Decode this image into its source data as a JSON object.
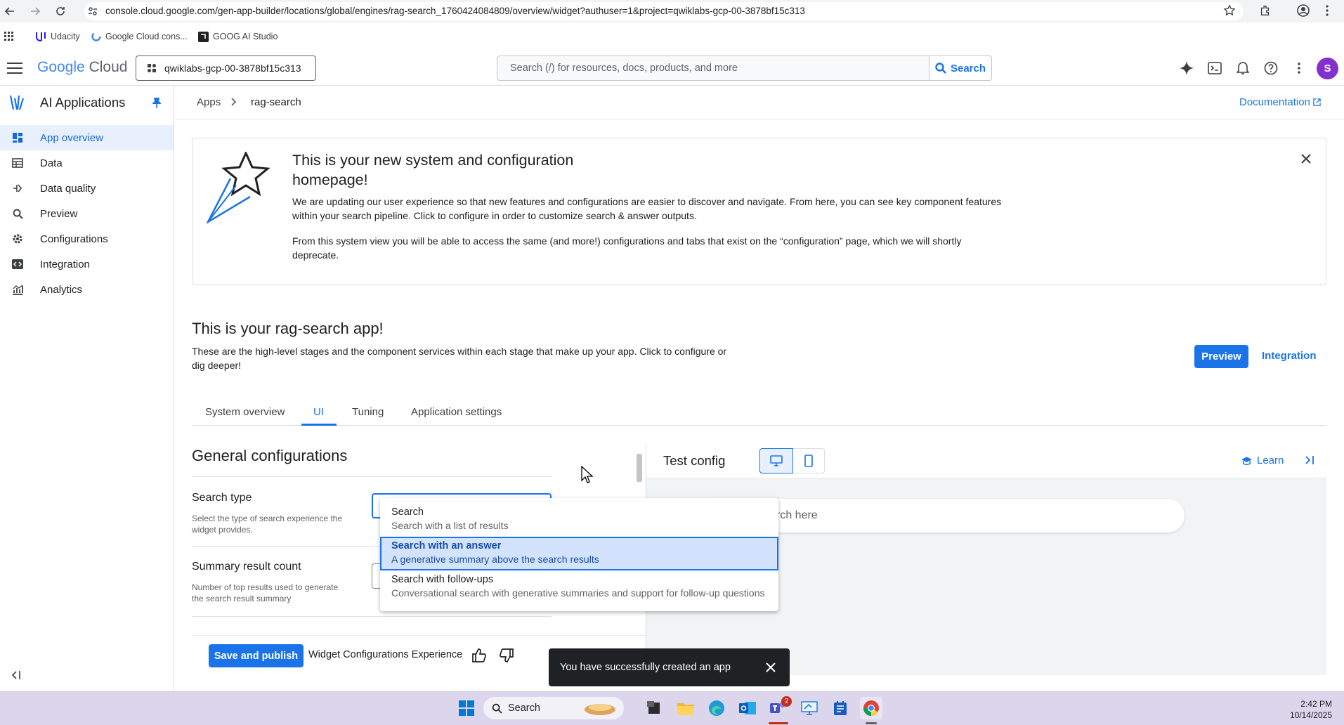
{
  "browser": {
    "url": "console.cloud.google.com/gen-app-builder/locations/global/engines/rag-search_1760424084809/overview/widget?authuser=1&project=qwiklabs-gcp-00-3878bf15c313",
    "bookmarks": [
      "Udacity",
      "Google Cloud cons...",
      "GOOG AI Studio"
    ]
  },
  "header": {
    "logo_google": "Google",
    "logo_cloud": "Cloud",
    "project": "qwiklabs-gcp-00-3878bf15c313",
    "search_placeholder": "Search (/) for resources, docs, products, and more",
    "search_button": "Search",
    "avatar_letter": "S"
  },
  "sidebar": {
    "title": "AI Applications",
    "items": [
      {
        "label": "App overview",
        "icon": "dashboard-icon"
      },
      {
        "label": "Data",
        "icon": "table-icon"
      },
      {
        "label": "Data quality",
        "icon": "quality-icon"
      },
      {
        "label": "Preview",
        "icon": "search-icon"
      },
      {
        "label": "Configurations",
        "icon": "gear-icon"
      },
      {
        "label": "Integration",
        "icon": "code-icon"
      },
      {
        "label": "Analytics",
        "icon": "analytics-icon"
      }
    ]
  },
  "breadcrumb": {
    "apps": "Apps",
    "current": "rag-search",
    "documentation": "Documentation"
  },
  "banner": {
    "title_line1": "This is your new system and configuration",
    "title_line2": "homepage!",
    "para1_line1": "We are updating our user experience so that new features and configurations are easier to discover and navigate. From here, you can see key component features",
    "para1_line2": "within your search pipeline. Click to configure in order to customize search & answer outputs.",
    "para2_line1": "From this system view you will be able to access the same (and more!) configurations and tabs that exist on the “configuration” page, which we will shortly",
    "para2_line2": "deprecate."
  },
  "main": {
    "title": "This is your rag-search app!",
    "desc_line1": "These are the high-level stages and the component services within each stage that make up your app. Click to configure or",
    "desc_line2": "dig deeper!",
    "preview_button": "Preview",
    "integration_button": "Integration",
    "tabs": [
      "System overview",
      "UI",
      "Tuning",
      "Application settings"
    ],
    "active_tab": "UI"
  },
  "config": {
    "section_title": "General configurations",
    "search_type_label": "Search type",
    "search_type_help_1": "Select the type of search experience the",
    "search_type_help_2": "widget provides.",
    "summary_label": "Summary result count",
    "summary_help_1": "Number of top results used to generate",
    "summary_help_2": "the search result summary",
    "save_button": "Save and publish",
    "feedback_label": "Widget Configurations Experience"
  },
  "dropdown": {
    "options": [
      {
        "title": "Search",
        "subtitle": "Search with a list of results"
      },
      {
        "title": "Search with an answer",
        "subtitle": "A generative summary above the search results"
      },
      {
        "title": "Search with follow-ups",
        "subtitle": "Conversational search with generative summaries and support for follow-up questions"
      }
    ],
    "selected_index": 1
  },
  "test_panel": {
    "title": "Test config",
    "learn": "Learn",
    "search_placeholder_visible": "rch here"
  },
  "snackbar": {
    "message": "You have successfully created an app"
  },
  "taskbar": {
    "search": "Search",
    "teams_badge": "2",
    "time": "2:42 PM",
    "date": "10/14/2025"
  },
  "colors": {
    "accent": "#1a73e8",
    "active_nav_bg": "#e8f0fe",
    "selected_option_bg": "#d3e3fd",
    "snackbar_bg": "#202124",
    "taskbar_bg": "#dcd6ec"
  }
}
